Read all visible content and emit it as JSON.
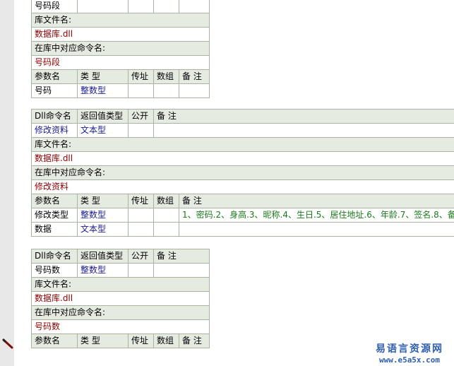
{
  "section1": {
    "top_row": {
      "name": "号码段"
    },
    "lib_file_label": "库文件名:",
    "lib_file_value": "数据库.dll",
    "lib_cmd_label": "在库中对应命令名:",
    "lib_cmd_value": "号码段",
    "param_headers": [
      "参数名",
      "类 型",
      "传址",
      "数组",
      "备 注"
    ],
    "params": [
      {
        "name": "号码",
        "type": "整数型",
        "note": ""
      }
    ]
  },
  "section2": {
    "cmd_headers": [
      "Dll命令名",
      "返回值类型",
      "公开",
      "备 注"
    ],
    "cmd": {
      "name": "修改资料",
      "ret": "文本型"
    },
    "lib_file_label": "库文件名:",
    "lib_file_value": "数据库.dll",
    "lib_cmd_label": "在库中对应命令名:",
    "lib_cmd_value": "修改资料",
    "param_headers": [
      "参数名",
      "类 型",
      "传址",
      "数组",
      "备 注"
    ],
    "params": [
      {
        "name": "修改类型",
        "type": "整数型",
        "note": "1、密码.2、身高.3、昵称.4、生日.5、居住地址.6、年龄.7、签名.8、备"
      },
      {
        "name": "数据",
        "type": "文本型",
        "note": ""
      }
    ]
  },
  "section3": {
    "cmd_headers": [
      "Dll命令名",
      "返回值类型",
      "公开",
      "备 注"
    ],
    "cmd": {
      "name": "号码数",
      "ret": "整数型"
    },
    "lib_file_label": "库文件名:",
    "lib_file_value": "数据库.dll",
    "lib_cmd_label": "在库中对应命令名:",
    "lib_cmd_value": "号码数",
    "param_headers": [
      "参数名",
      "类 型",
      "传址",
      "数组",
      "备 注"
    ]
  },
  "watermark": {
    "title": "易语言资源网",
    "url": "www.e5a5x.com"
  },
  "colors": {
    "header_bg": "#e6ebe2",
    "border": "#a9b3a0",
    "lib_value": "#8b0000",
    "type_value": "#1a1a8c",
    "note_value": "#1a7a1a"
  },
  "icons": [
    "pencil-icon"
  ]
}
